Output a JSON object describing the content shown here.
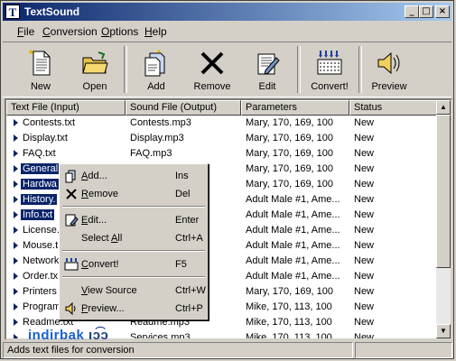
{
  "window": {
    "title": "TextSound"
  },
  "menu": [
    {
      "label": "File",
      "u": "F",
      "rest": "ile"
    },
    {
      "label": "Conversion",
      "u": "C",
      "rest": "onversion"
    },
    {
      "label": "Options",
      "u": "O",
      "rest": "ptions"
    },
    {
      "label": "Help",
      "u": "H",
      "rest": "elp"
    }
  ],
  "toolbar": {
    "new": "New",
    "open": "Open",
    "add": "Add",
    "remove": "Remove",
    "edit": "Edit",
    "convert": "Convert!",
    "preview": "Preview"
  },
  "columns": [
    "Text File (Input)",
    "Sound File (Output)",
    "Parameters",
    "Status"
  ],
  "rows": [
    {
      "file": "Contests.txt",
      "sound": "Contests.mp3",
      "params": "Mary, 170, 169, 100",
      "status": "New"
    },
    {
      "file": "Display.txt",
      "sound": "Display.mp3",
      "params": "Mary, 170, 169, 100",
      "status": "New"
    },
    {
      "file": "FAQ.txt",
      "sound": "FAQ.mp3",
      "params": "Mary, 170, 169, 100",
      "status": "New"
    },
    {
      "file": "General",
      "sound": "",
      "params": "Mary, 170, 169, 100",
      "status": "New"
    },
    {
      "file": "Hardwa",
      "sound": "",
      "params": "Mary, 170, 169, 100",
      "status": "New"
    },
    {
      "file": "History.",
      "sound": "",
      "params": "Adult Male #1, Ame...",
      "status": "New"
    },
    {
      "file": "Info.txt",
      "sound": "",
      "params": "Adult Male #1, Ame...",
      "status": "New"
    },
    {
      "file": "License.",
      "sound": "",
      "params": "Adult Male #1, Ame...",
      "status": "New"
    },
    {
      "file": "Mouse.t",
      "sound": "",
      "params": "Adult Male #1, Ame...",
      "status": "New"
    },
    {
      "file": "Network",
      "sound": "",
      "params": "Adult Male #1, Ame...",
      "status": "New"
    },
    {
      "file": "Order.tx",
      "sound": "",
      "params": "Adult Male #1, Ame...",
      "status": "New"
    },
    {
      "file": "Printers",
      "sound": "",
      "params": "Mary, 170, 169, 100",
      "status": "New"
    },
    {
      "file": "Program",
      "sound": "",
      "params": "Mike, 170, 113, 100",
      "status": "New"
    },
    {
      "file": "Readme.txt",
      "sound": "Readme.mp3",
      "params": "Mike, 170, 113, 100",
      "status": "New"
    },
    {
      "file": "",
      "sound": "Services.mp3",
      "params": "Mike, 170, 113, 100",
      "status": "New"
    }
  ],
  "context_menu": [
    {
      "label": "Add...",
      "u": "A",
      "rest": "dd...",
      "key": "Ins"
    },
    {
      "label": "Remove",
      "u": "R",
      "rest": "emove",
      "key": "Del"
    },
    {
      "label": "Edit...",
      "u": "E",
      "rest": "dit...",
      "key": "Enter"
    },
    {
      "label": "Select All",
      "pre": "Select ",
      "u": "A",
      "rest": "ll",
      "key": "Ctrl+A"
    },
    {
      "label": "Convert!",
      "u": "C",
      "rest": "onvert!",
      "key": "F5"
    },
    {
      "label": "View Source",
      "u": "V",
      "rest": "iew Source",
      "key": "Ctrl+W"
    },
    {
      "label": "Preview...",
      "u": "P",
      "rest": "review...",
      "key": "Ctrl+P"
    }
  ],
  "status_bar": "Adds text files for conversion",
  "watermark": "indirbak",
  "colors": {
    "selection": "#0a246a",
    "title_start": "#0a246a",
    "title_end": "#a6caf0"
  }
}
